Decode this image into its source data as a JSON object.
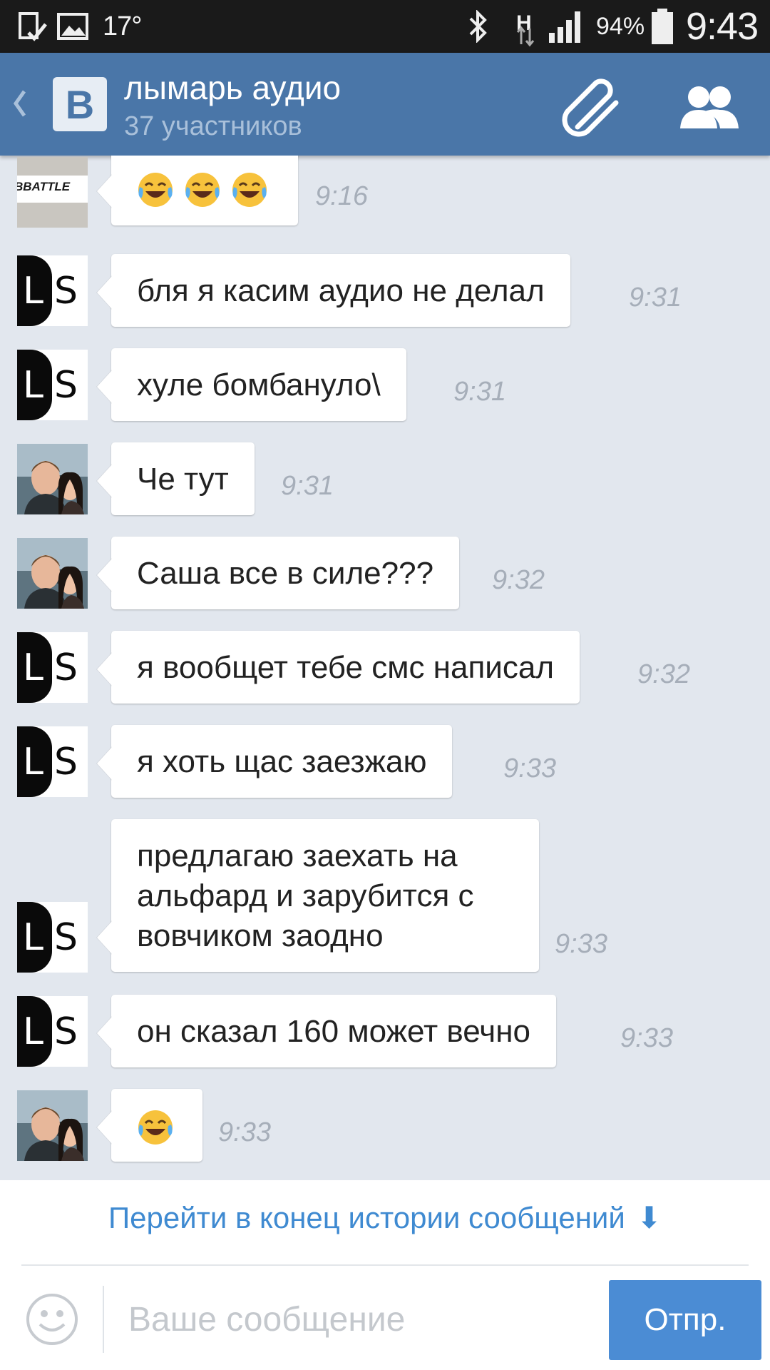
{
  "status_bar": {
    "temperature": "17°",
    "network_type": "H",
    "battery": "94%",
    "time": "9:43"
  },
  "header": {
    "logo_letter": "B",
    "title": "лымарь аудио",
    "subtitle": "37 участников"
  },
  "messages": [
    {
      "avatar": "battle-logo",
      "avatar_text": "BBATTLE",
      "text": "",
      "emoji_count": 3,
      "time": "9:16"
    },
    {
      "avatar": "ls-logo",
      "text": "бля я касим аудио не делал",
      "time": "9:31"
    },
    {
      "avatar": "ls-logo",
      "text": "хуле бомбануло\\",
      "time": "9:31"
    },
    {
      "avatar": "couple-photo",
      "text": "Че тут",
      "time": "9:31"
    },
    {
      "avatar": "couple-photo",
      "text": "Саша все в силе???",
      "time": "9:32"
    },
    {
      "avatar": "ls-logo",
      "text": "я вообщет тебе смс написал",
      "time": "9:32"
    },
    {
      "avatar": "ls-logo",
      "text": "я хоть щас заезжаю",
      "time": "9:33"
    },
    {
      "avatar": "ls-logo",
      "text": "предлагаю заехать на альфард и зарубится с вовчиком заодно",
      "time": "9:33"
    },
    {
      "avatar": "ls-logo",
      "text": "он сказал 160 может вечно",
      "time": "9:33"
    },
    {
      "avatar": "couple-photo",
      "text": "",
      "emoji_count": 1,
      "time": "9:33"
    }
  ],
  "ls_logo": {
    "left": "L",
    "right": "S"
  },
  "bottom": {
    "jump_link": "Перейти в конец истории сообщений",
    "jump_arrow": "⬇",
    "input_placeholder": "Ваше сообщение",
    "send_label": "Отпр."
  },
  "colors": {
    "header": "#4a76a8",
    "chat_background": "#e2e7ee",
    "link": "#3f8ad1",
    "send_button": "#4b8cd4",
    "time_text": "#a6aeb9"
  },
  "icons": {
    "back": "chevron-left-icon",
    "attach": "paperclip-icon",
    "members": "group-icon",
    "emoji": "crying-laughing-emoji",
    "smile": "smiley-icon"
  }
}
